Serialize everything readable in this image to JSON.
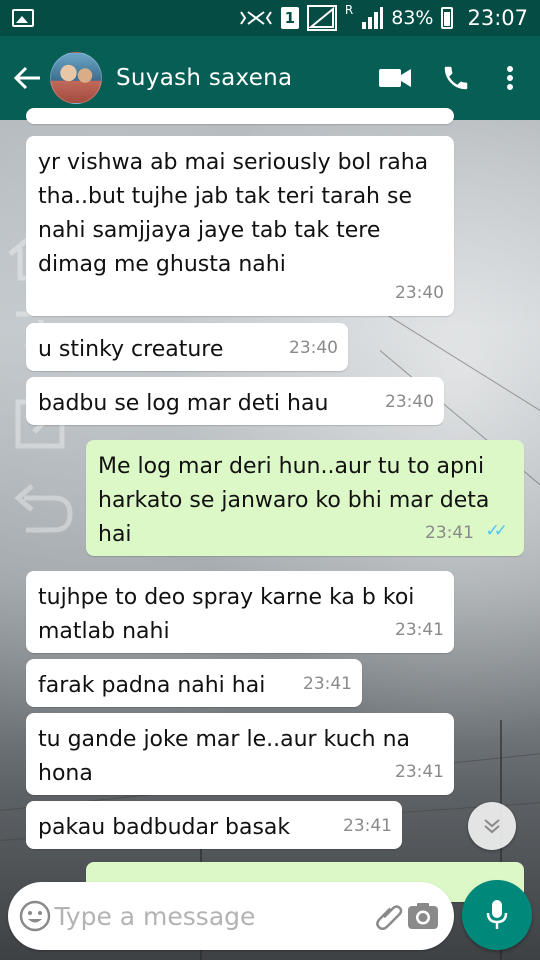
{
  "status_bar": {
    "sim_label": "1",
    "roaming_label": "R",
    "battery_percent": "83%",
    "time": "23:07"
  },
  "header": {
    "contact_name": "Suyash saxena",
    "icons": [
      "back-arrow-icon",
      "avatar",
      "video-call-icon",
      "phone-icon",
      "more-vert-icon"
    ]
  },
  "messages": [
    {
      "direction": "in",
      "text": "yr vishwa ab mai seriously bol raha tha..but tujhe jab tak teri tarah se nahi samjjaya jaye tab tak tere dimag me ghusta nahi",
      "time": "23:40"
    },
    {
      "direction": "in",
      "text": "u stinky creature",
      "time": "23:40"
    },
    {
      "direction": "in",
      "text": "badbu se log mar deti hau",
      "time": "23:40"
    },
    {
      "direction": "out",
      "text": "Me log mar deri hun..aur tu to apni harkato se janwaro ko bhi mar deta hai",
      "time": "23:41",
      "status": "read"
    },
    {
      "direction": "in",
      "text": "tujhpe to deo spray karne ka b koi matlab nahi",
      "time": "23:41"
    },
    {
      "direction": "in",
      "text": "farak padna nahi hai",
      "time": "23:41"
    },
    {
      "direction": "in",
      "text": "tu gande joke mar le..aur kuch na hona",
      "time": "23:41"
    },
    {
      "direction": "in",
      "text": "pakau badbudar basak",
      "time": "23:41"
    }
  ],
  "composer": {
    "placeholder": "Type a message"
  },
  "colors": {
    "status_bar": "#054d44",
    "header": "#075e54",
    "incoming_bubble": "#ffffff",
    "outgoing_bubble": "#dcf8c6",
    "mic_button": "#00897b",
    "read_ticks": "#4fc3f7"
  }
}
